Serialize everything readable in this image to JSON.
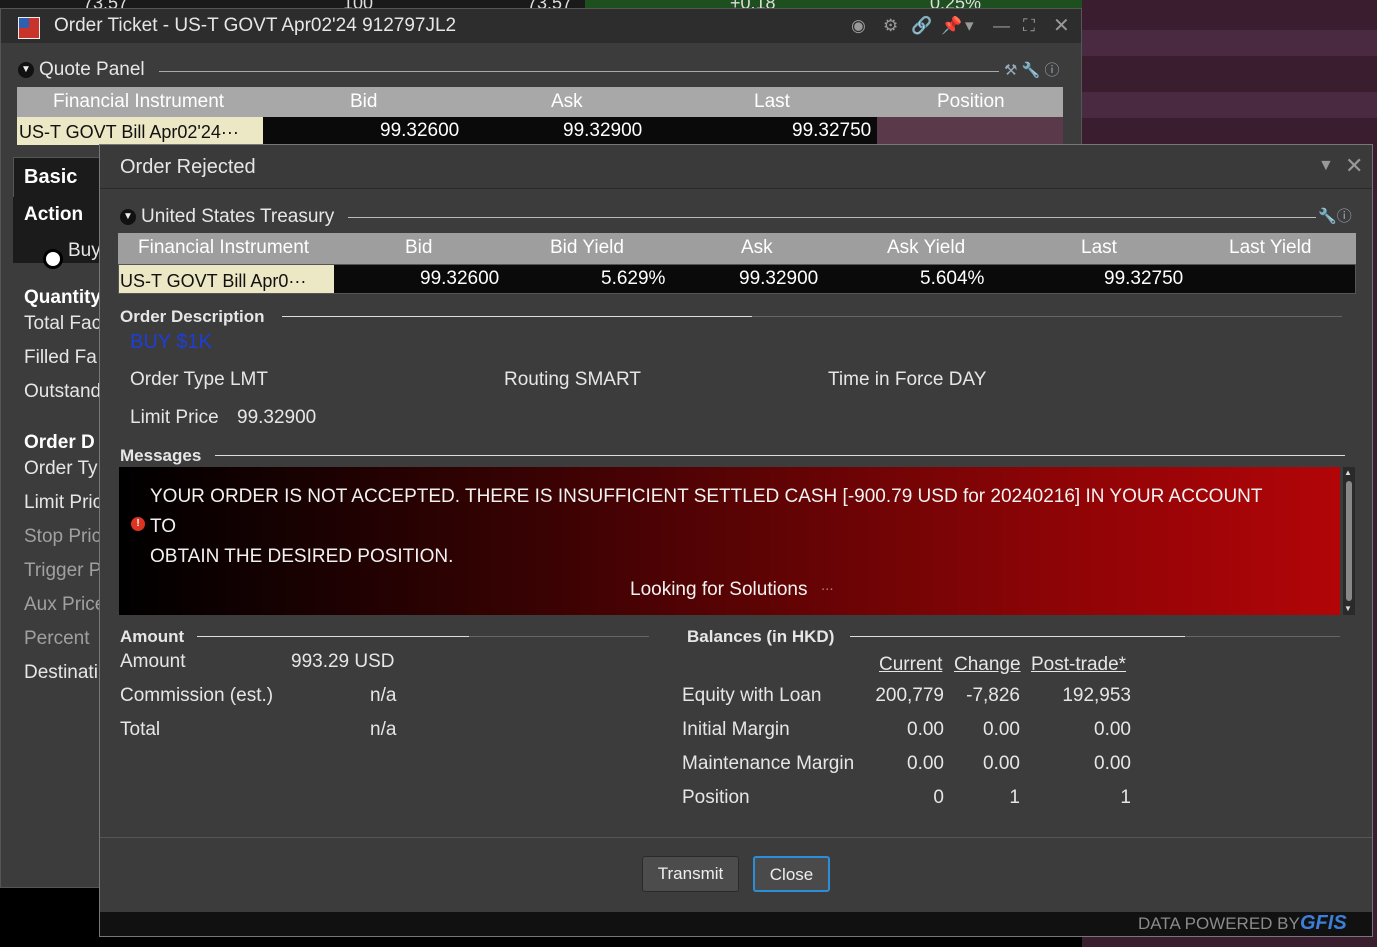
{
  "background": {
    "partial_numbers": [
      "73.57",
      "100",
      "73.57",
      "+0.18",
      "0.25%"
    ]
  },
  "ticket": {
    "title": "Order Ticket - US-T GOVT Apr02'24 912797JL2",
    "quote_panel": {
      "title": "Quote Panel",
      "columns": [
        "Financial Instrument",
        "Bid",
        "Ask",
        "Last",
        "Position"
      ],
      "row": {
        "instrument": "US-T GOVT Bill Apr02'24···",
        "bid": "99.32600",
        "ask": "99.32900",
        "last": "99.32750",
        "position": ""
      }
    },
    "tab_basic": "Basic",
    "action_label": "Action",
    "buy_label": "Buy",
    "labels": {
      "quantity": "Quantity",
      "total_face": "Total Fac",
      "filled_face": "Filled Fa",
      "outstanding": "Outstand",
      "order_desc": "Order D",
      "order_type": "Order Ty",
      "limit_price": "Limit Pric",
      "stop_price": "Stop Pric",
      "trigger": "Trigger P",
      "aux_price": "Aux Price",
      "percent": "Percent",
      "destination": "Destinati"
    }
  },
  "dialog": {
    "title": "Order Rejected",
    "treasury": {
      "title": "United States Treasury",
      "columns": [
        "Financial Instrument",
        "Bid",
        "Bid Yield",
        "Ask",
        "Ask Yield",
        "Last",
        "Last Yield"
      ],
      "row": {
        "instrument": "US-T GOVT Bill Apr0···",
        "bid": "99.32600",
        "bid_yield": "5.629%",
        "ask": "99.32900",
        "ask_yield": "5.604%",
        "last": "99.32750",
        "last_yield": ""
      }
    },
    "order_description": {
      "title": "Order Description",
      "summary": "BUY $1K",
      "order_type": "Order Type LMT",
      "routing": "Routing SMART",
      "time_in_force": "Time in Force DAY",
      "limit_price_label": "Limit Price",
      "limit_price_value": "99.32900"
    },
    "messages": {
      "title": "Messages",
      "line1": "YOUR ORDER IS NOT ACCEPTED. THERE IS INSUFFICIENT SETTLED CASH [-900.79 USD for 20240216] IN YOUR ACCOUNT",
      "line2": "TO",
      "line3": "OBTAIN THE DESIRED POSITION.",
      "solutions": "Looking for Solutions",
      "dots": "..."
    },
    "amount": {
      "title": "Amount",
      "rows": [
        {
          "label": "Amount",
          "value": "993.29 USD"
        },
        {
          "label": "Commission (est.)",
          "value": "n/a"
        },
        {
          "label": "Total",
          "value": "n/a"
        }
      ]
    },
    "balances": {
      "title": "Balances (in HKD)",
      "columns": [
        "Current",
        "Change",
        "Post-trade*"
      ],
      "rows": [
        {
          "label": "Equity with Loan",
          "current": "200,779",
          "change": "-7,826",
          "post": "192,953"
        },
        {
          "label": "Initial Margin",
          "current": "0.00",
          "change": "0.00",
          "post": "0.00"
        },
        {
          "label": "Maintenance Margin",
          "current": "0.00",
          "change": "0.00",
          "post": "0.00"
        },
        {
          "label": "Position",
          "current": "0",
          "change": "1",
          "post": "1"
        }
      ]
    },
    "buttons": {
      "transmit": "Transmit",
      "close": "Close"
    },
    "footer": {
      "powered_by": "DATA POWERED BY",
      "brand": "GFIS"
    }
  }
}
